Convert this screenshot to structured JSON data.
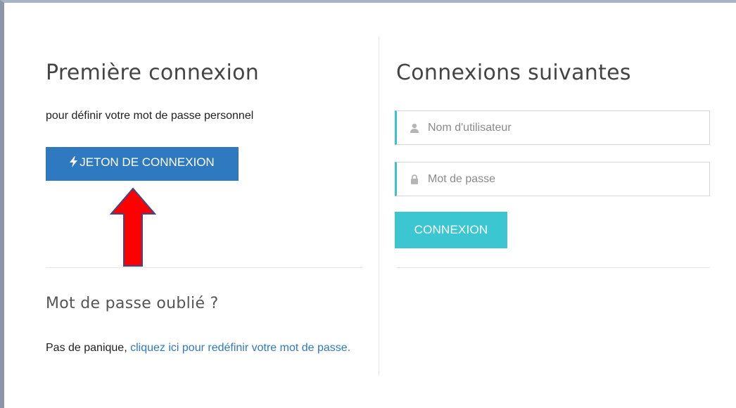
{
  "first_login": {
    "title": "Première connexion",
    "subtitle": "pour définir votre mot de passe personnel",
    "token_button": {
      "icon": "bolt-icon",
      "label": "JETON DE CONNEXION"
    }
  },
  "annotation": {
    "arrow_color": "#ff0000",
    "arrow_outline": "#3a4a8a",
    "arrow_direction": "up"
  },
  "forgot_password": {
    "title": "Mot de passe oublié ?",
    "text_prefix": "Pas de panique, ",
    "link_text": "cliquez ici pour redéfinir votre mot de passe."
  },
  "next_logins": {
    "title": "Connexions suivantes",
    "username": {
      "icon": "user-icon",
      "placeholder": "Nom d'utilisateur",
      "value": ""
    },
    "password": {
      "icon": "lock-icon",
      "placeholder": "Mot de passe",
      "value": ""
    },
    "login_button": "CONNEXION"
  },
  "colors": {
    "primary_blue": "#2f79c1",
    "accent_teal": "#3cc6d2"
  }
}
